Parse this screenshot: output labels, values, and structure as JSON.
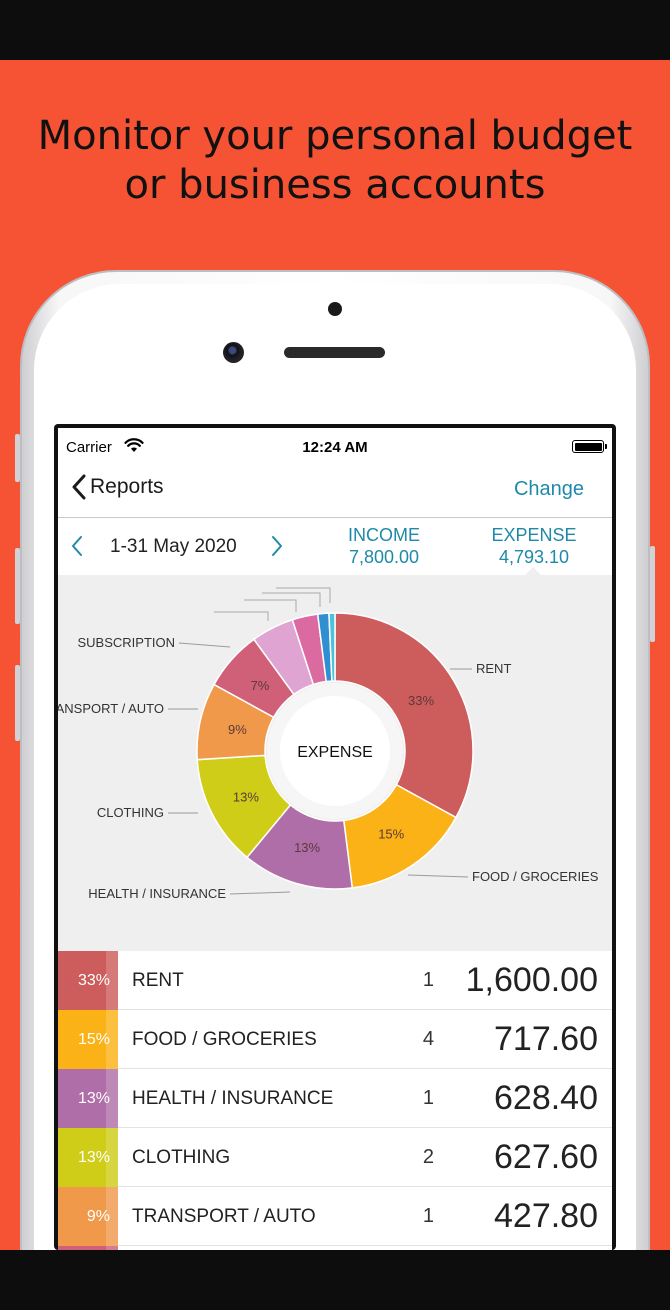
{
  "promo": {
    "headline_line1": "Monitor your personal budget",
    "headline_line2": "or business accounts",
    "background_color": "#f55334"
  },
  "status_bar": {
    "carrier": "Carrier",
    "time": "12:24 AM",
    "icons": [
      "wifi-icon",
      "battery-icon"
    ]
  },
  "navbar": {
    "back_label": "Reports",
    "action_label": "Change"
  },
  "period_bar": {
    "period": "1-31 May 2020",
    "income_label": "INCOME",
    "income_value": "7,800.00",
    "expense_label": "EXPENSE",
    "expense_value": "4,793.10"
  },
  "chart_data": {
    "type": "pie",
    "center_label": "EXPENSE",
    "slices": [
      {
        "label": "RENT",
        "percent": 33,
        "pct_label": "33%",
        "color": "#cd5c5c"
      },
      {
        "label": "FOOD / GROCERIES",
        "percent": 15,
        "pct_label": "15%",
        "color": "#fbb217"
      },
      {
        "label": "HEALTH / INSURANCE",
        "percent": 13,
        "pct_label": "13%",
        "color": "#b06ea8"
      },
      {
        "label": "CLOTHING",
        "percent": 13,
        "pct_label": "13%",
        "color": "#cfcd18"
      },
      {
        "label": "TRANSPORT / AUTO",
        "percent": 9,
        "pct_label": "9%",
        "color": "#f0994a"
      },
      {
        "label": "SUBSCRIPTION",
        "percent": 7,
        "pct_label": "7%",
        "color": "#d06078"
      },
      {
        "label": "",
        "percent": 5,
        "pct_label": "",
        "color": "#dfa4d2"
      },
      {
        "label": "",
        "percent": 3,
        "pct_label": "",
        "color": "#db6aa0"
      },
      {
        "label": "",
        "percent": 1.3,
        "pct_label": "",
        "color": "#2f8fd0"
      },
      {
        "label": "",
        "percent": 0.7,
        "pct_label": "",
        "color": "#4cc3d8"
      }
    ]
  },
  "rows": [
    {
      "pct": "33%",
      "name": "RENT",
      "count": "1",
      "amount": "1,600.00",
      "color": "#cd5c5c"
    },
    {
      "pct": "15%",
      "name": "FOOD / GROCERIES",
      "count": "4",
      "amount": "717.60",
      "color": "#fbb217"
    },
    {
      "pct": "13%",
      "name": "HEALTH / INSURANCE",
      "count": "1",
      "amount": "628.40",
      "color": "#b06ea8"
    },
    {
      "pct": "13%",
      "name": "CLOTHING",
      "count": "2",
      "amount": "627.60",
      "color": "#cfcd18"
    },
    {
      "pct": "9%",
      "name": "TRANSPORT / AUTO",
      "count": "1",
      "amount": "427.80",
      "color": "#f0994a"
    },
    {
      "pct": "",
      "name": "",
      "count": "",
      "amount": "",
      "color": "#d06078"
    }
  ]
}
